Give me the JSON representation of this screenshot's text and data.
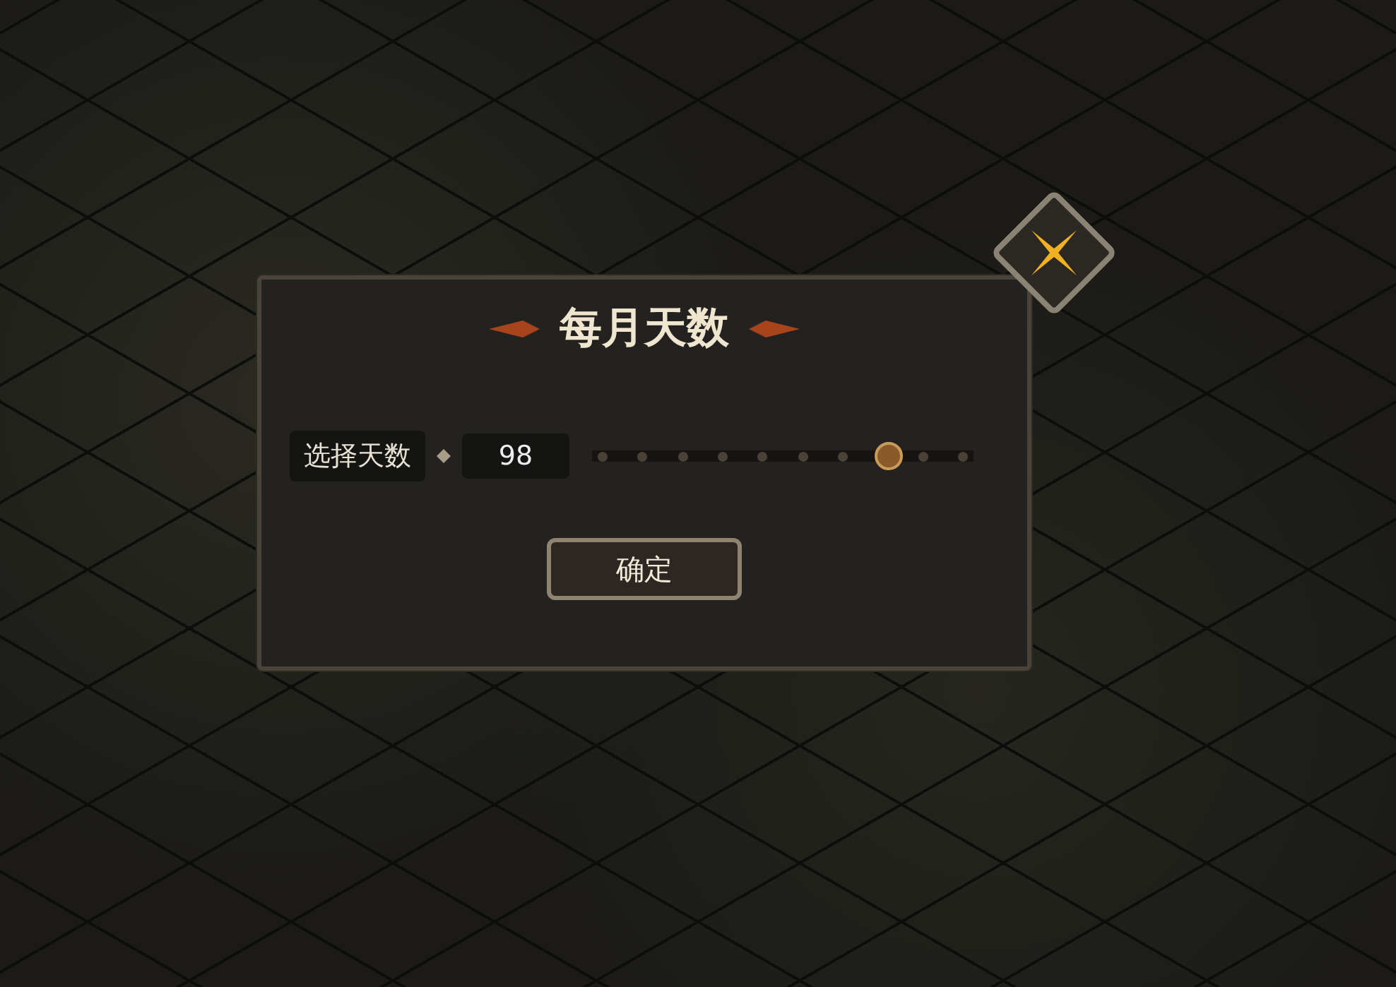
{
  "dialog": {
    "title": "每月天数"
  },
  "days_setting": {
    "label": "选择天数",
    "value": "98",
    "level": 0.8
  },
  "buttons": [
    {
      "label": "确定"
    }
  ]
}
